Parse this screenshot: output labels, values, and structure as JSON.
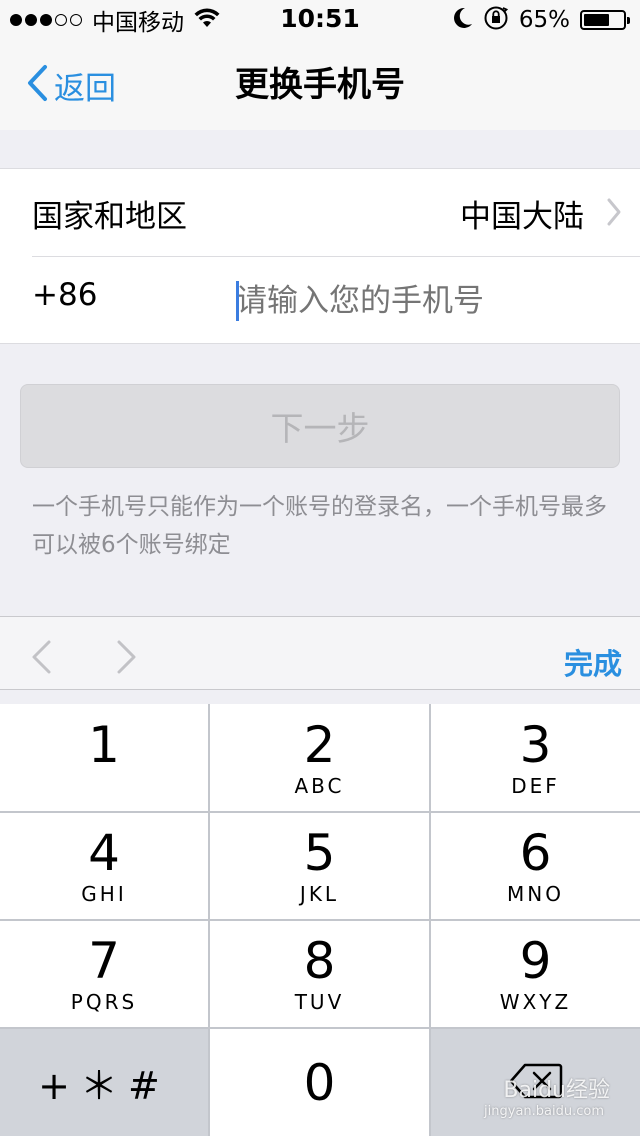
{
  "status_bar": {
    "carrier": "中国移动",
    "time": "10:51",
    "battery_percent": "65%",
    "battery_level": 0.65,
    "signal_dots_filled": 3,
    "signal_dots_total": 5,
    "icons": [
      "wifi-icon",
      "moon-icon",
      "orientation-lock-icon",
      "battery-icon"
    ]
  },
  "nav": {
    "back_label": "返回",
    "title": "更换手机号"
  },
  "form": {
    "region_label": "国家和地区",
    "region_value": "中国大陆",
    "country_code": "+86",
    "phone_placeholder": "请输入您的手机号"
  },
  "next_button_label": "下一步",
  "hint": "一个手机号只能作为一个账号的登录名，一个手机号最多可以被6个账号绑定",
  "accessory": {
    "done_label": "完成"
  },
  "keypad": {
    "keys": [
      {
        "num": "1",
        "letters": ""
      },
      {
        "num": "2",
        "letters": "ABC"
      },
      {
        "num": "3",
        "letters": "DEF"
      },
      {
        "num": "4",
        "letters": "GHI"
      },
      {
        "num": "5",
        "letters": "JKL"
      },
      {
        "num": "6",
        "letters": "MNO"
      },
      {
        "num": "7",
        "letters": "PQRS"
      },
      {
        "num": "8",
        "letters": "TUV"
      },
      {
        "num": "9",
        "letters": "WXYZ"
      },
      {
        "num": "0",
        "letters": ""
      }
    ],
    "symbols_label": "+＊#"
  },
  "watermark": {
    "text": "Baidu经验",
    "sub": "jingyan.baidu.com"
  },
  "colors": {
    "accent": "#2a8fe0",
    "background": "#efeff4",
    "keypad_bg": "#c3c6cc"
  }
}
